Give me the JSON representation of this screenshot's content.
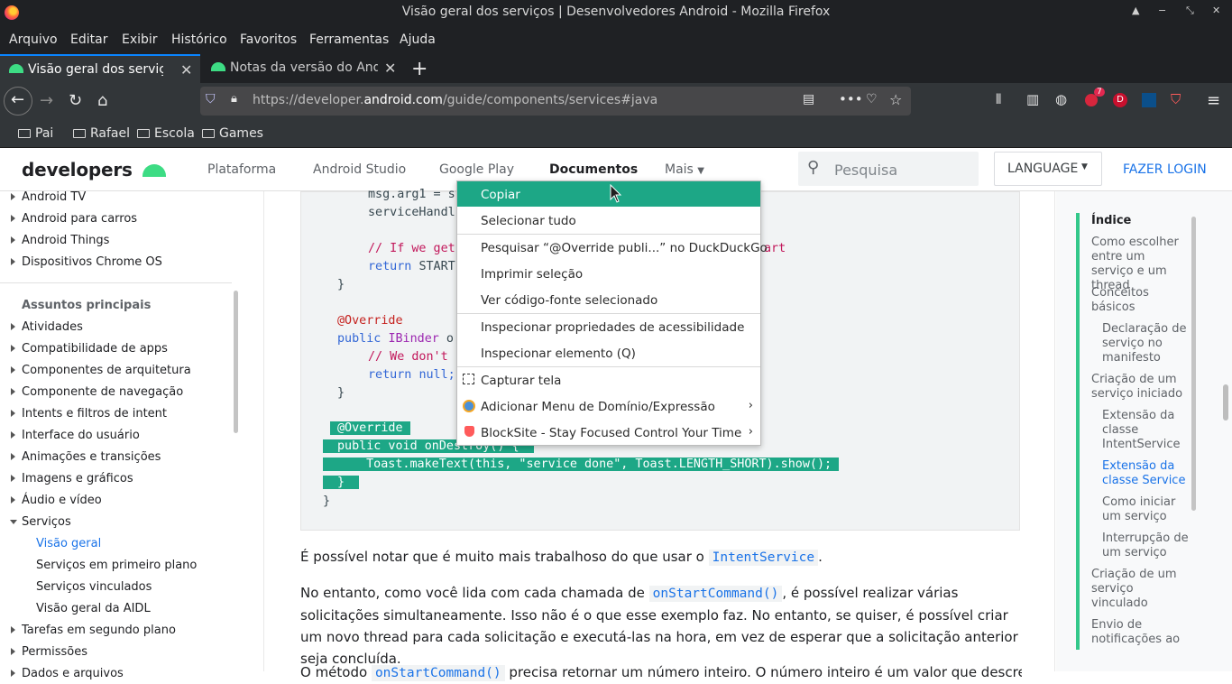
{
  "window": {
    "title": "Visão geral dos serviços  |  Desenvolvedores Android - Mozilla Firefox"
  },
  "menubar": [
    "Arquivo",
    "Editar",
    "Exibir",
    "Histórico",
    "Favoritos",
    "Ferramentas",
    "Ajuda"
  ],
  "tabs": [
    {
      "label": "Visão geral dos serviços",
      "active": true
    },
    {
      "label": "Notas da versão do Android",
      "active": false
    }
  ],
  "url": {
    "prefix": "https://developer.",
    "domain": "android.com",
    "path": "/guide/components/services#java"
  },
  "extension_badge": "7",
  "bookmarks": [
    "Pai",
    "Rafael",
    "Escola",
    "Games"
  ],
  "site": {
    "logo": "developers",
    "nav": [
      "Plataforma",
      "Android Studio",
      "Google Play",
      "Documentos",
      "Mais"
    ],
    "search_placeholder": "Pesquisa",
    "language": "LANGUAGE",
    "login": "FAZER LOGIN"
  },
  "leftnav": {
    "top_items": [
      "Android TV",
      "Android para carros",
      "Android Things",
      "Dispositivos Chrome OS"
    ],
    "section_title": "Assuntos principais",
    "items": [
      "Atividades",
      "Compatibilidade de apps",
      "Componentes de arquitetura",
      "Componente de navegação",
      "Intents e filtros de intent",
      "Interface do usuário",
      "Animações e transições",
      "Imagens e gráficos",
      "Áudio e vídeo",
      "Serviços"
    ],
    "sub_items": [
      "Visão geral",
      "Serviços em primeiro plano",
      "Serviços vinculados",
      "Visão geral da AIDL"
    ],
    "after_items": [
      "Tarefas em segundo plano",
      "Permissões"
    ],
    "partial_item": "Dados e arquivos"
  },
  "code": {
    "l1": "msg.arg1 = s",
    "l2": "serviceHandl",
    "l3": "// If we get",
    "l3b": "art",
    "l4a": "return ",
    "l4b": "START",
    "l5": "}",
    "l6": "@Override",
    "l7a": "public ",
    "l7b": "IBinder",
    "l7c": " o",
    "l8": "// We don't",
    "l9a": "return ",
    "l9b": "null;",
    "l10": "}",
    "l11": "@Override",
    "l12": "public void onDestroy() {",
    "l13": "  Toast.makeText(this, \"service done\", Toast.LENGTH_SHORT).show();",
    "l14": "}",
    "l15": "}"
  },
  "paragraphs": {
    "p1_before": "É possível notar que é muito mais trabalhoso do que usar o ",
    "p1_code": "IntentService",
    "p1_after": ".",
    "p2_before": "No entanto, como você lida com cada chamada de ",
    "p2_code": "onStartCommand()",
    "p2_after": ", é possível realizar várias solicitações simultaneamente. Isso não é o que esse exemplo faz. No entanto, se quiser, é possível criar um novo thread para cada solicitação e executá-las na hora, em vez de esperar que a solicitação anterior seja concluída.",
    "p3_before": "O método ",
    "p3_code": "onStartCommand()",
    "p3_after": " precisa retornar um número inteiro. O número inteiro é um valor que descreve"
  },
  "toc": {
    "title": "Índice",
    "entries": [
      "Como escolher entre um serviço e um thread",
      "Conceitos básicos",
      "Declaração de serviço no manifesto",
      "Criação de um serviço iniciado",
      "Extensão da classe IntentService",
      "Extensão da classe Service",
      "Como iniciar um serviço",
      "Interrupção de um serviço",
      "Criação de um serviço vinculado",
      "Envio de notificações ao"
    ]
  },
  "context_menu": {
    "items": [
      "Copiar",
      "Selecionar tudo",
      "Pesquisar “@Override publi...” no DuckDuckGo",
      "Imprimir seleção",
      "Ver código-fonte selecionado",
      "Inspecionar propriedades de acessibilidade",
      "Inspecionar elemento (Q)",
      "Capturar tela",
      "Adicionar Menu de Domínio/Expressão",
      "BlockSite - Stay Focused  Control Your Time"
    ],
    "highlight_color": "#1da786"
  }
}
